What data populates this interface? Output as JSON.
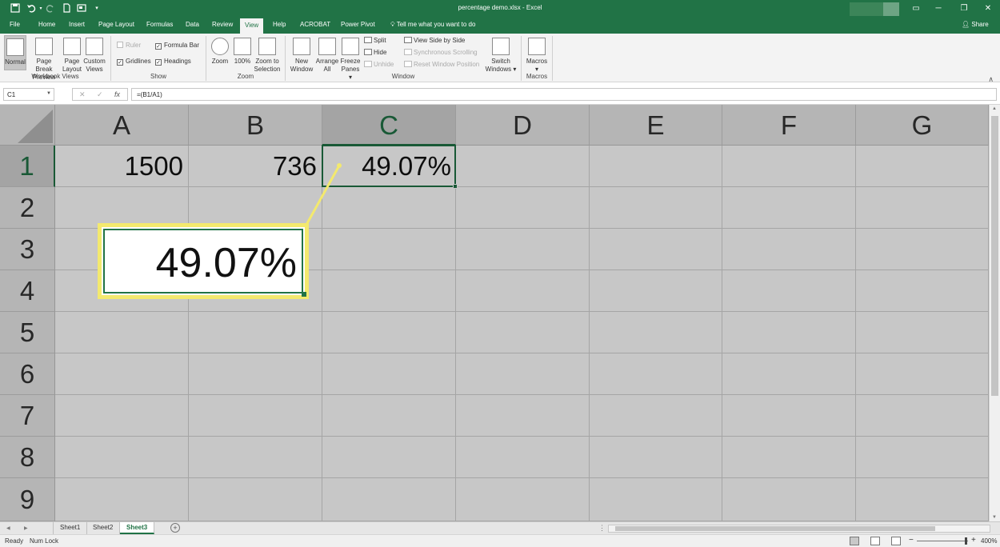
{
  "app": {
    "title": "percentage demo.xlsx  -  Excel"
  },
  "quick_access": {
    "save_icon": "save-icon",
    "undo_icon": "undo-icon",
    "redo_icon": "redo-icon"
  },
  "window": {
    "minimize": "─",
    "restore": "❐",
    "close": "✕"
  },
  "tabs": [
    "File",
    "Home",
    "Insert",
    "Page Layout",
    "Formulas",
    "Data",
    "Review",
    "View",
    "Help",
    "ACROBAT",
    "Power Pivot"
  ],
  "active_tab": "View",
  "tell_me": "Tell me what you want to do",
  "share": "Share",
  "ribbon": {
    "workbook_views": {
      "group": "Workbook Views",
      "normal": "Normal",
      "page_break_l1": "Page Break",
      "page_break_l2": "Preview",
      "page_layout_l1": "Page",
      "page_layout_l2": "Layout",
      "custom_l1": "Custom",
      "custom_l2": "Views"
    },
    "show": {
      "group": "Show",
      "ruler": "Ruler",
      "formula_bar": "Formula Bar",
      "gridlines": "Gridlines",
      "headings": "Headings"
    },
    "zoom": {
      "group": "Zoom",
      "zoom": "Zoom",
      "hundred": "100%",
      "zts_l1": "Zoom to",
      "zts_l2": "Selection"
    },
    "window": {
      "group": "Window",
      "new_l1": "New",
      "new_l2": "Window",
      "arrange_l1": "Arrange",
      "arrange_l2": "All",
      "freeze_l1": "Freeze",
      "freeze_l2": "Panes ▾",
      "split": "Split",
      "hide": "Hide",
      "unhide": "Unhide",
      "side_by_side": "View Side by Side",
      "sync": "Synchronous Scrolling",
      "reset": "Reset Window Position",
      "switch_l1": "Switch",
      "switch_l2": "Windows ▾"
    },
    "macros": {
      "group": "Macros",
      "macros": "Macros",
      "arrow": "▾"
    }
  },
  "formula_bar": {
    "name_box": "C1",
    "cancel": "✕",
    "enter": "✓",
    "fx": "fx",
    "formula": "=(B1/A1)"
  },
  "grid": {
    "columns": [
      "A",
      "B",
      "C",
      "D",
      "E",
      "F",
      "G"
    ],
    "rows": [
      "1",
      "2",
      "3",
      "4",
      "5",
      "6",
      "7",
      "8",
      "9"
    ],
    "cells": {
      "A1": "1500",
      "B1": "736",
      "C1": "49.07%"
    },
    "selected": "C1"
  },
  "callout": {
    "value": "49.07%"
  },
  "sheets": [
    "Sheet1",
    "Sheet2",
    "Sheet3"
  ],
  "active_sheet": "Sheet3",
  "add_sheet": "+",
  "status": {
    "ready": "Ready",
    "num_lock": "Num Lock",
    "zoom": "400%",
    "minus": "−",
    "plus": "+"
  }
}
